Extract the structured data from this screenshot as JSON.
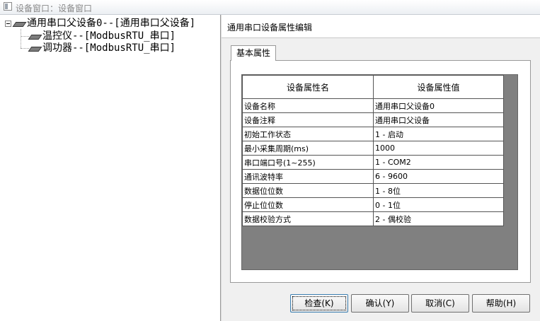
{
  "window": {
    "title": "设备窗口：设备窗口"
  },
  "tree": {
    "root": "通用串口父设备0--[通用串口父设备]",
    "children": [
      {
        "label": "温控仪--[ModbusRTU_串口]"
      },
      {
        "label": "调功器--[ModbusRTU_串口]"
      }
    ]
  },
  "panel": {
    "title": "通用串口设备属性编辑",
    "tab": "基本属性",
    "table": {
      "headers": [
        "设备属性名",
        "设备属性值"
      ],
      "rows": [
        [
          "设备名称",
          "通用串口父设备0"
        ],
        [
          "设备注释",
          "通用串口父设备"
        ],
        [
          "初始工作状态",
          "1 - 启动"
        ],
        [
          "最小采集周期(ms)",
          "1000"
        ],
        [
          "串口端口号(1~255)",
          "1 - COM2"
        ],
        [
          "通讯波特率",
          "6 - 9600"
        ],
        [
          "数据位位数",
          "1 - 8位"
        ],
        [
          "停止位位数",
          "0 - 1位"
        ],
        [
          "数据校验方式",
          "2 - 偶校验"
        ]
      ]
    },
    "buttons": {
      "check": "检查(K)",
      "confirm": "确认(Y)",
      "cancel": "取消(C)",
      "help": "帮助(H)"
    }
  }
}
